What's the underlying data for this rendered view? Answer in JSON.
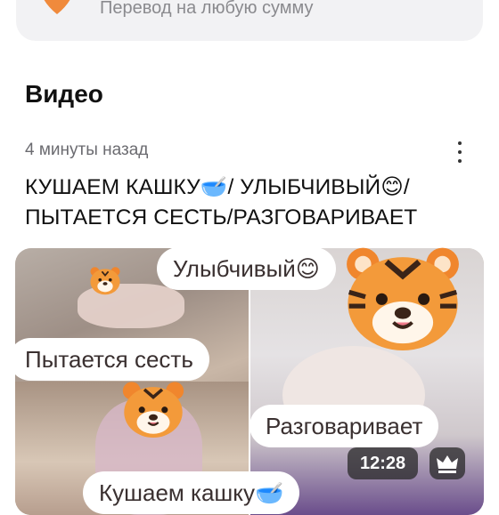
{
  "donate": {
    "subtitle": "Перевод на любую сумму",
    "icon": "heart-icon"
  },
  "section": {
    "title": "Видео"
  },
  "post": {
    "time_ago": "4 минуты назад",
    "title": "КУШАЕМ КАШКУ🥣/ УЛЫБЧИВЫЙ😊/ ПЫТАЕТСЯ СЕСТЬ/РАЗГОВАРИВАЕТ",
    "more_icon": "more-vertical-icon"
  },
  "video": {
    "captions": {
      "smiling": "Улыбчивый😊",
      "trying_to_sit": "Пытается сесть",
      "talking": "Разговаривает",
      "eating": "Кушаем кашку🥣"
    },
    "duration": "12:28",
    "premium_icon": "crown-icon"
  },
  "colors": {
    "accent": "#f08a3c",
    "card_bg": "#f2f2f4",
    "muted_text": "#6b6b70"
  }
}
